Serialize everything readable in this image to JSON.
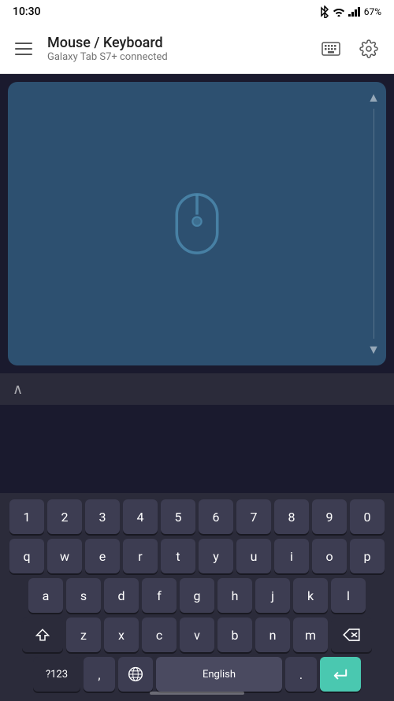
{
  "statusBar": {
    "time": "10:30",
    "battery": "67%"
  },
  "appBar": {
    "title": "Mouse / Keyboard",
    "subtitle": "Galaxy Tab S7+ connected"
  },
  "touchpad": {
    "scrollUpArrow": "▲",
    "scrollDownArrow": "▼"
  },
  "keyboard": {
    "row1": [
      "1",
      "2",
      "3",
      "4",
      "5",
      "6",
      "7",
      "8",
      "9",
      "0"
    ],
    "row2": [
      "q",
      "w",
      "e",
      "r",
      "t",
      "y",
      "u",
      "i",
      "o",
      "p"
    ],
    "row3": [
      "a",
      "s",
      "d",
      "f",
      "g",
      "h",
      "j",
      "k",
      "l"
    ],
    "row4": [
      "z",
      "x",
      "c",
      "v",
      "b",
      "n",
      "m"
    ],
    "bottomRow": {
      "numSymLabel": "?123",
      "commaLabel": ",",
      "spaceLabel": "English",
      "periodLabel": ".",
      "enterSymbol": "↵"
    }
  },
  "bottomBar": {
    "chevron": "∧"
  },
  "icons": {
    "menu": "menu-icon",
    "keyboard": "keyboard-icon",
    "settings": "gear-icon",
    "mouse": "mouse-icon",
    "bluetooth": "bluetooth-icon",
    "wifi": "wifi-icon",
    "signal": "signal-icon",
    "battery": "battery-icon",
    "globe": "globe-icon",
    "shift": "shift-icon",
    "backspace": "backspace-icon"
  }
}
